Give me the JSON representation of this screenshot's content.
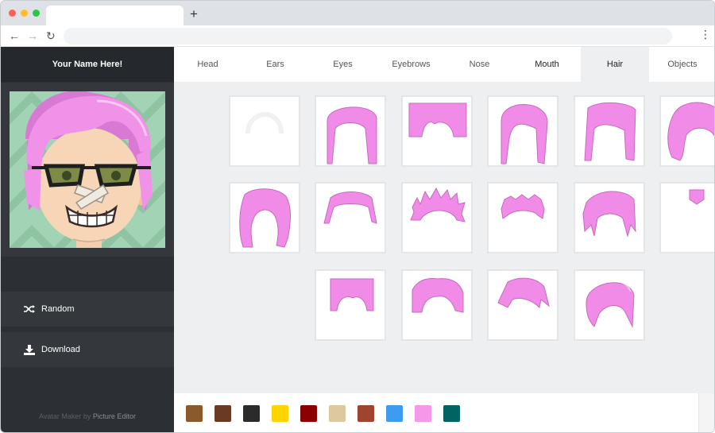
{
  "browser": {
    "new_tab": "+",
    "back": "←",
    "forward": "→",
    "reload": "↻",
    "menu": "⋮"
  },
  "sidebar": {
    "title": "Your Name Here!",
    "random_label": "Random",
    "download_label": "Download",
    "footer_prefix": "Avatar Maker by ",
    "footer_link": "Picture Editor"
  },
  "tabs": [
    {
      "label": "Head"
    },
    {
      "label": "Ears"
    },
    {
      "label": "Eyes"
    },
    {
      "label": "Eyebrows"
    },
    {
      "label": "Nose"
    },
    {
      "label": "Mouth"
    },
    {
      "label": "Hair"
    },
    {
      "label": "Objects"
    }
  ],
  "active_tab": "Hair",
  "hair_color": "#f08ce8",
  "palette": [
    "#8b5a2b",
    "#6b3a22",
    "#2b2b2b",
    "#ffd400",
    "#8b0000",
    "#dcc9a0",
    "#a0432f",
    "#3d9bf0",
    "#f598ea",
    "#006462"
  ]
}
